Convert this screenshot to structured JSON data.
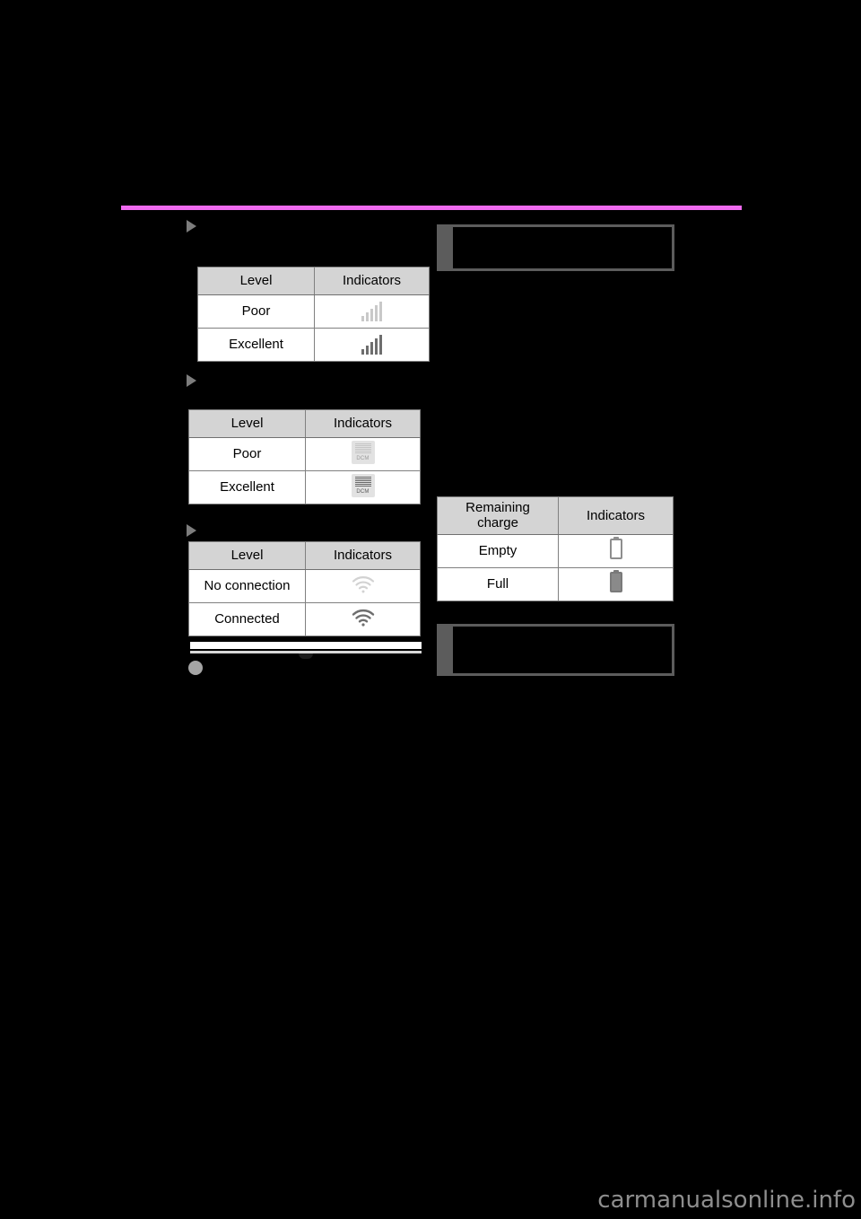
{
  "page": {
    "background_color": "#000000",
    "header_rule_color": "#f06af0",
    "watermark": "carmanualsonline.info"
  },
  "left_column": {
    "sections": [
      {
        "name": "cellular-signal-section",
        "bullet_icon": "triangle-right-icon"
      },
      {
        "name": "dcm-signal-section",
        "bullet_icon": "triangle-right-icon"
      },
      {
        "name": "wifi-connection-section",
        "bullet_icon": "triangle-right-icon"
      }
    ],
    "tables": [
      {
        "name": "cellular-signal-table",
        "headers": [
          "Level",
          "Indicators"
        ],
        "rows": [
          {
            "label": "Poor",
            "icon": "signal-bars-weak-icon"
          },
          {
            "label": "Excellent",
            "icon": "signal-bars-strong-icon"
          }
        ]
      },
      {
        "name": "dcm-signal-table",
        "headers": [
          "Level",
          "Indicators"
        ],
        "rows": [
          {
            "label": "Poor",
            "icon": "dcm-weak-icon",
            "icon_label": "DCM"
          },
          {
            "label": "Excellent",
            "icon": "dcm-strong-icon",
            "icon_label": "DCM"
          }
        ]
      },
      {
        "name": "wifi-connection-table",
        "headers": [
          "Level",
          "Indicators"
        ],
        "rows": [
          {
            "label": "No connection",
            "icon": "wifi-off-icon"
          },
          {
            "label": "Connected",
            "icon": "wifi-on-icon"
          }
        ]
      }
    ],
    "footer": {
      "divider_name": "page-divider",
      "bullet_icon": "circle-bullet-icon"
    }
  },
  "right_column": {
    "callouts": [
      {
        "name": "notice-box-top",
        "accent_color": "#5c5c5c",
        "text": ""
      },
      {
        "name": "notice-box-bottom",
        "accent_color": "#5c5c5c",
        "text": ""
      }
    ],
    "tables": [
      {
        "name": "battery-charge-table",
        "headers": [
          "Remaining charge",
          "Indicators"
        ],
        "header_line1": "Remaining",
        "header_line2": "charge",
        "rows": [
          {
            "label": "Empty",
            "icon": "battery-empty-icon"
          },
          {
            "label": "Full",
            "icon": "battery-full-icon"
          }
        ]
      }
    ]
  }
}
